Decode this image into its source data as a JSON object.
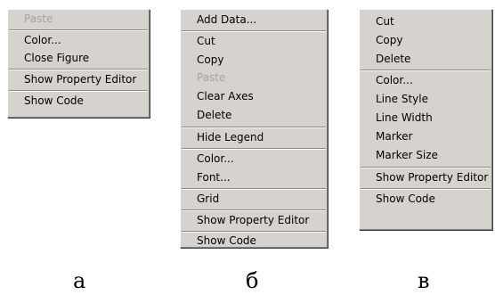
{
  "menu_a": {
    "paste": "Paste",
    "color": "Color...",
    "close_figure": "Close Figure",
    "show_property_editor": "Show Property Editor",
    "show_code": "Show Code"
  },
  "menu_b": {
    "add_data": "Add Data...",
    "cut": "Cut",
    "copy": "Copy",
    "paste": "Paste",
    "clear_axes": "Clear Axes",
    "delete": "Delete",
    "hide_legend": "Hide Legend",
    "color": "Color...",
    "font": "Font...",
    "grid": "Grid",
    "show_property_editor": "Show Property Editor",
    "show_code": "Show Code"
  },
  "menu_c": {
    "cut": "Cut",
    "copy": "Copy",
    "delete": "Delete",
    "color": "Color...",
    "line_style": "Line Style",
    "line_width": "Line Width",
    "marker": "Marker",
    "marker_size": "Marker Size",
    "show_property_editor": "Show Property Editor",
    "show_code": "Show Code"
  },
  "captions": {
    "a": "а",
    "b": "б",
    "c": "в"
  },
  "colors": {
    "menu_background": "#d6d3ce",
    "disabled_text": "#a6a39e"
  }
}
